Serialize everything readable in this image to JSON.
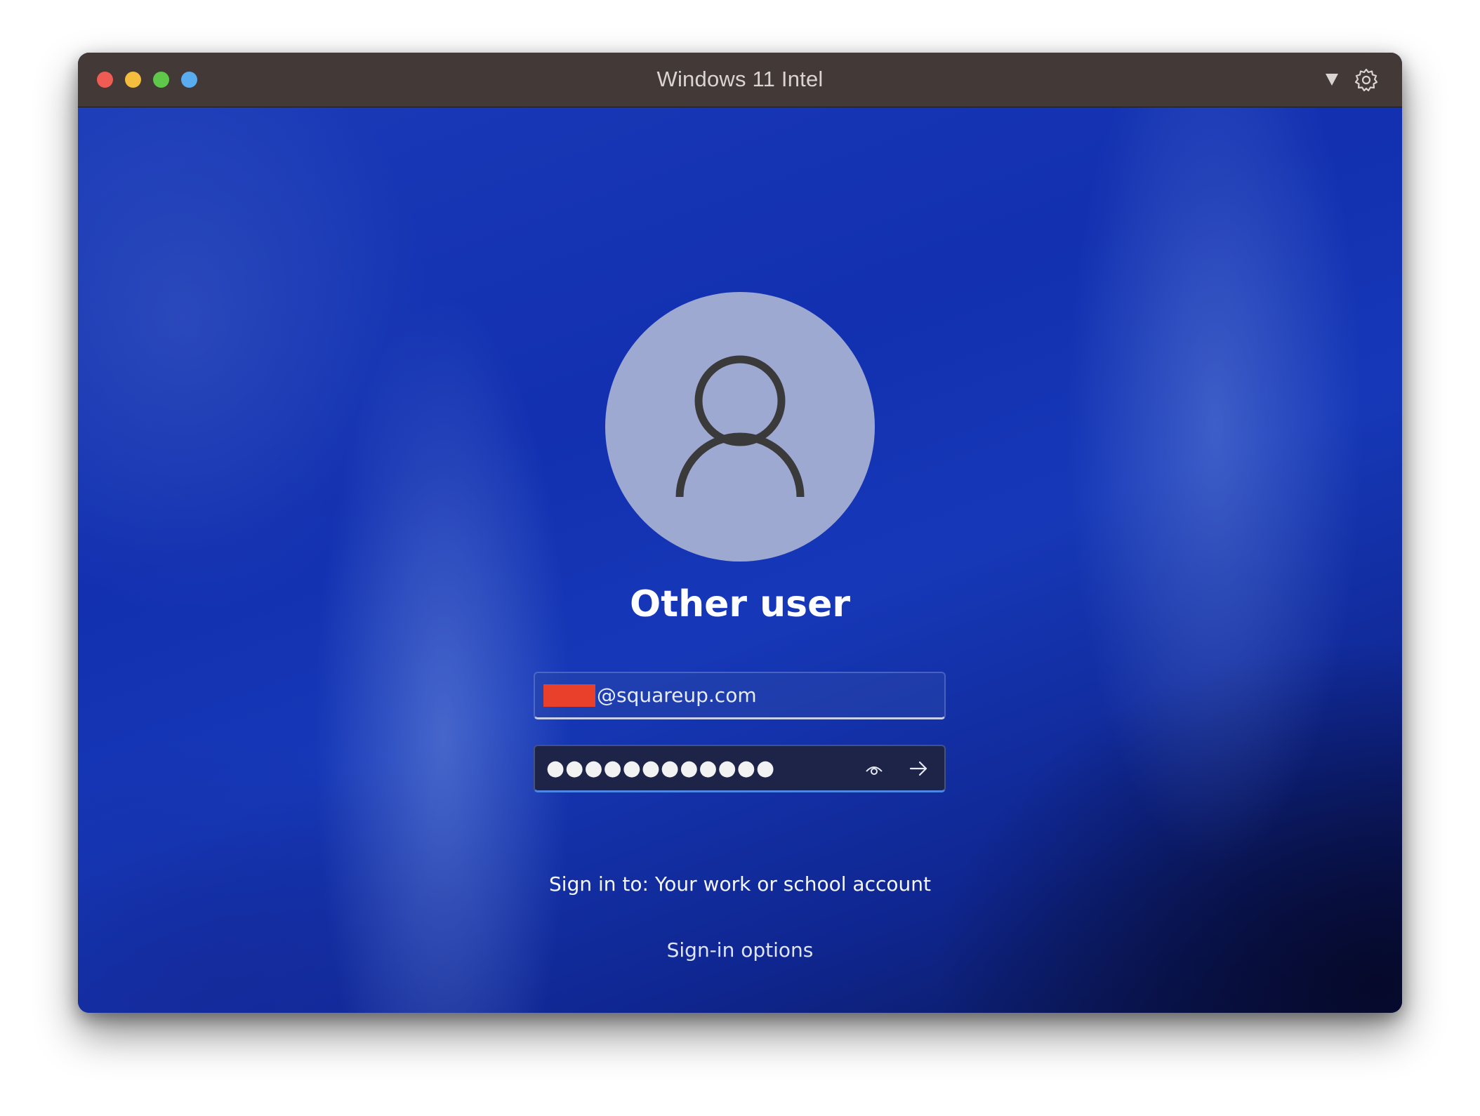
{
  "window": {
    "title": "Windows 11 Intel"
  },
  "login": {
    "username": "Other user",
    "email_visible": "@squareup.com",
    "password_mask": "●●●●●●●●●●●●",
    "sign_in_to": "Sign in to: Your work or school account",
    "sign_in_options": "Sign-in options"
  },
  "icons": {
    "avatar": "user-silhouette",
    "reveal": "eye-icon",
    "submit": "arrow-right-icon",
    "network": "network-icon",
    "accessibility": "accessibility-icon",
    "power": "power-icon",
    "dropdown": "triangle-down-icon",
    "settings": "gear-icon"
  },
  "colors": {
    "titlebar": "#433936",
    "close": "#ef5c53",
    "minimize": "#f5bd3e",
    "maximize": "#5fc84a",
    "extra": "#5aacf0",
    "redaction": "#e8402a",
    "password_underline": "#4f87e6"
  }
}
